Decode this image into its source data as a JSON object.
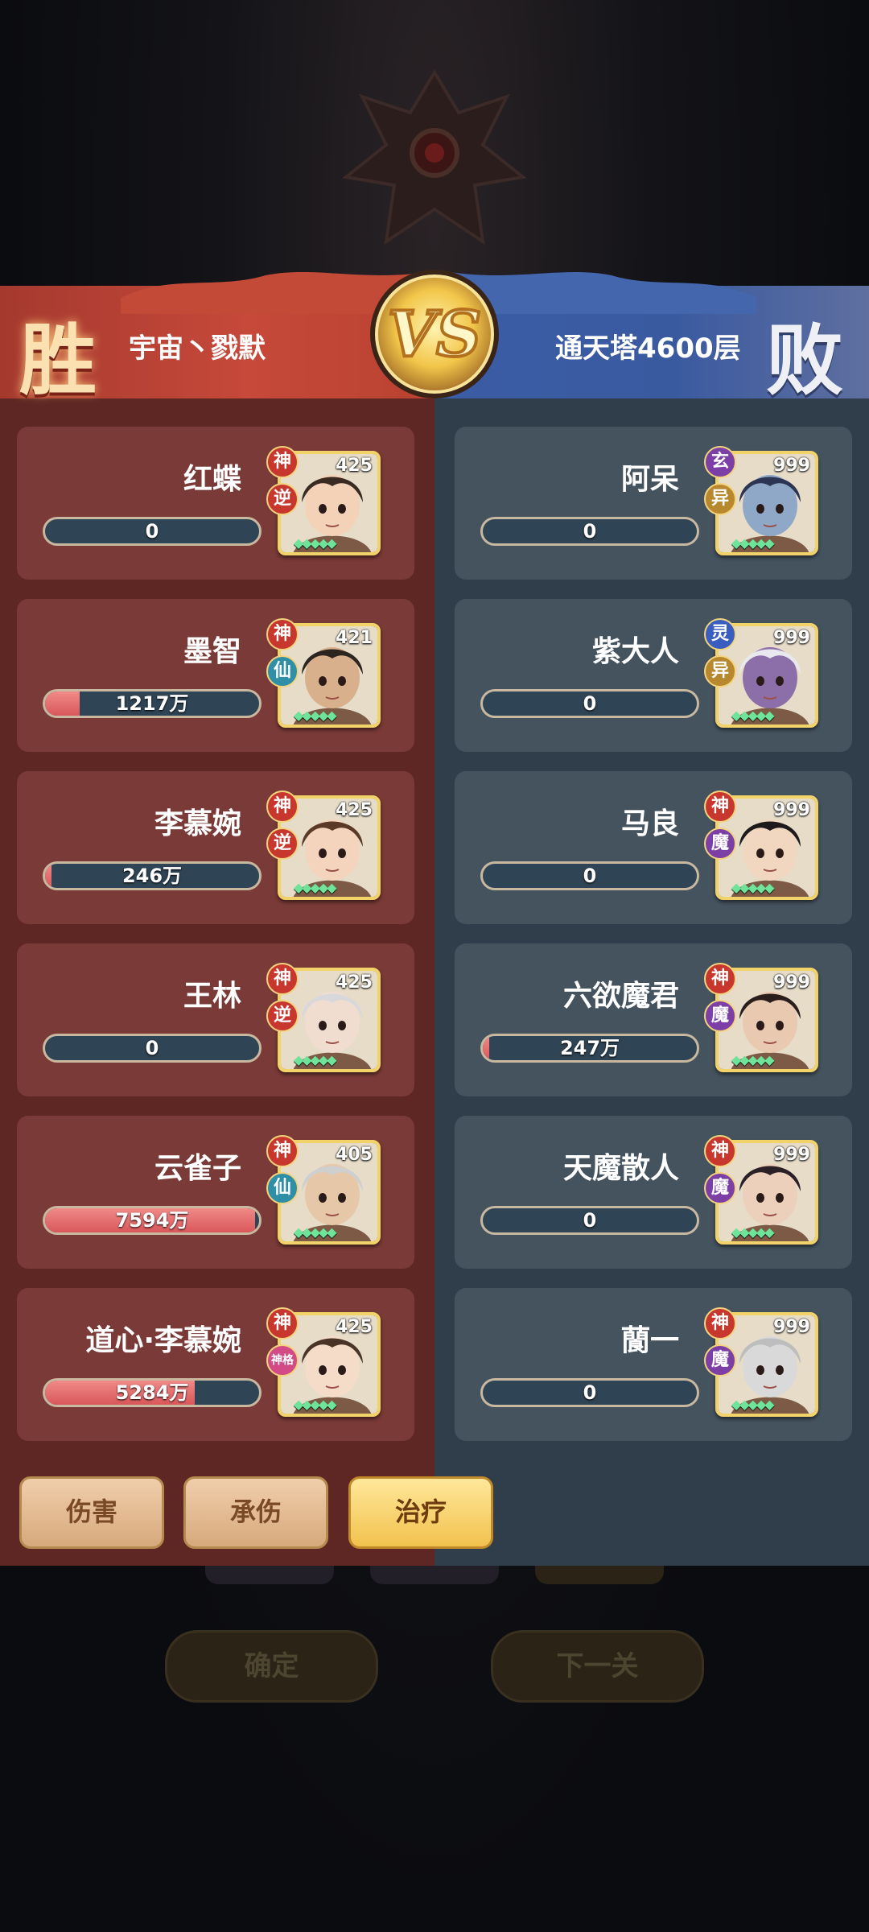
{
  "header": {
    "win_label": "胜",
    "lose_label": "败",
    "left_team": "宇宙丶戮默",
    "right_team": "通天塔4600层",
    "vs_icon": "vs-emblem"
  },
  "left_heroes": [
    {
      "name": "红蝶",
      "value": "0",
      "fill": 0,
      "level": "425",
      "badge1": "神",
      "badge2": "逆",
      "hair": "#3a2a22",
      "skin": "#f3d2b8"
    },
    {
      "name": "墨智",
      "value": "1217万",
      "fill": 0.16,
      "level": "421",
      "badge1": "神",
      "badge2": "仙",
      "hair": "#2d2520",
      "skin": "#d8b08c"
    },
    {
      "name": "李慕婉",
      "value": "246万",
      "fill": 0.03,
      "level": "425",
      "badge1": "神",
      "badge2": "逆",
      "hair": "#5a3a26",
      "skin": "#f4d4bd"
    },
    {
      "name": "王林",
      "value": "0",
      "fill": 0,
      "level": "425",
      "badge1": "神",
      "badge2": "逆",
      "hair": "#d8d8dc",
      "skin": "#f1dcd0"
    },
    {
      "name": "云雀子",
      "value": "7594万",
      "fill": 0.98,
      "level": "405",
      "badge1": "神",
      "badge2": "仙",
      "hair": "#cfcfcf",
      "skin": "#e6c8a8"
    },
    {
      "name": "道心·李慕婉",
      "value": "5284万",
      "fill": 0.7,
      "level": "425",
      "badge1": "神",
      "badge2": "神格",
      "hair": "#4a3428",
      "skin": "#f5dcc8"
    }
  ],
  "right_heroes": [
    {
      "name": "阿呆",
      "value": "0",
      "fill": 0,
      "level": "999",
      "badge1": "玄",
      "badge2": "异",
      "hair": "#2c3552",
      "skin": "#8fa8c8"
    },
    {
      "name": "紫大人",
      "value": "0",
      "fill": 0,
      "level": "999",
      "badge1": "灵",
      "badge2": "异",
      "hair": "#e8e8ee",
      "skin": "#8c6fa8"
    },
    {
      "name": "马良",
      "value": "0",
      "fill": 0,
      "level": "999",
      "badge1": "神",
      "badge2": "魔",
      "hair": "#1e1a1c",
      "skin": "#f1d6c0"
    },
    {
      "name": "六欲魔君",
      "value": "247万",
      "fill": 0.03,
      "level": "999",
      "badge1": "神",
      "badge2": "魔",
      "hair": "#2a1e1c",
      "skin": "#e9c9b0"
    },
    {
      "name": "天魔散人",
      "value": "0",
      "fill": 0,
      "level": "999",
      "badge1": "神",
      "badge2": "魔",
      "hair": "#2a2026",
      "skin": "#ecd0bc"
    },
    {
      "name": "䕞一",
      "value": "0",
      "fill": 0,
      "level": "999",
      "badge1": "神",
      "badge2": "魔",
      "hair": "#bdbdbd",
      "skin": "#d9d9d9"
    }
  ],
  "tabs": [
    {
      "label": "伤害",
      "active": false
    },
    {
      "label": "承伤",
      "active": false
    },
    {
      "label": "治疗",
      "active": true
    }
  ],
  "footer": {
    "confirm": "确定",
    "next": "下一关"
  },
  "colors": {
    "badge_red": "#c8372e",
    "badge_teal": "#2e8fa6",
    "badge_purple": "#7b3fa6",
    "badge_blue": "#3a5ec0",
    "badge_gold": "#b8882e",
    "badge_pink": "#d24b86"
  }
}
